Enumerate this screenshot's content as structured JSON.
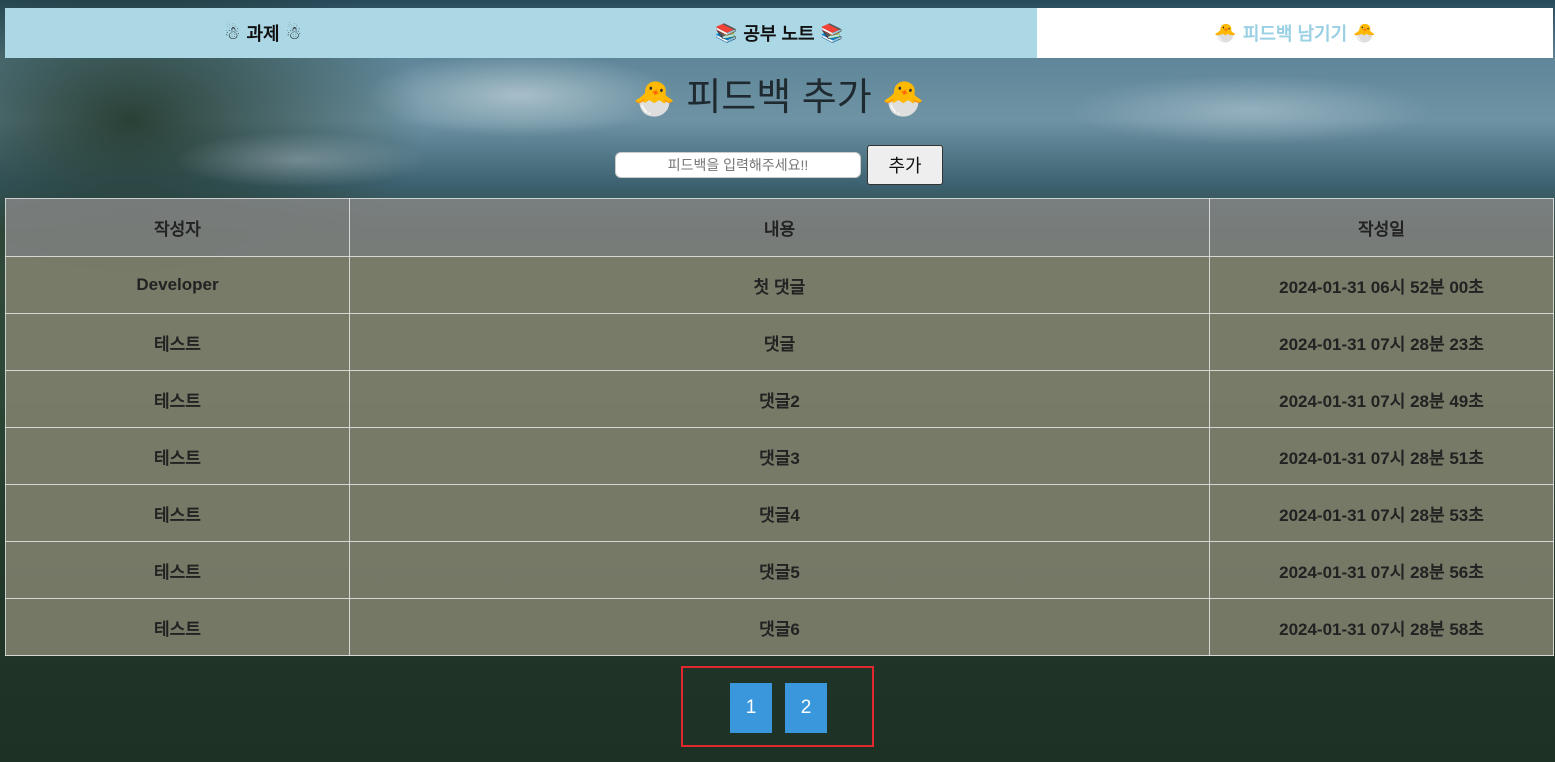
{
  "tabs": [
    {
      "label": "과제",
      "icon": "☃"
    },
    {
      "label": "공부 노트",
      "icon": "📚"
    },
    {
      "label": "피드백 남기기",
      "icon": "🐣"
    }
  ],
  "active_tab": 2,
  "title": {
    "text": "피드백 추가",
    "icon": "🐣"
  },
  "feedback_form": {
    "placeholder": "피드백을 입력해주세요!!",
    "value": "",
    "add_label": "추가"
  },
  "table": {
    "headers": [
      "작성자",
      "내용",
      "작성일"
    ],
    "rows": [
      [
        "Developer",
        "첫 댓글",
        "2024-01-31 06시 52분 00초"
      ],
      [
        "테스트",
        "댓글",
        "2024-01-31 07시 28분 23초"
      ],
      [
        "테스트",
        "댓글2",
        "2024-01-31 07시 28분 49초"
      ],
      [
        "테스트",
        "댓글3",
        "2024-01-31 07시 28분 51초"
      ],
      [
        "테스트",
        "댓글4",
        "2024-01-31 07시 28분 53초"
      ],
      [
        "테스트",
        "댓글5",
        "2024-01-31 07시 28분 56초"
      ],
      [
        "테스트",
        "댓글6",
        "2024-01-31 07시 28분 58초"
      ]
    ]
  },
  "pagination": {
    "pages": [
      "1",
      "2"
    ]
  },
  "colors": {
    "tab_bg": "#acd8e6",
    "active_tab_text": "#9ad0e3",
    "page_button": "#3b97dc",
    "highlight_border": "#e0282e"
  }
}
